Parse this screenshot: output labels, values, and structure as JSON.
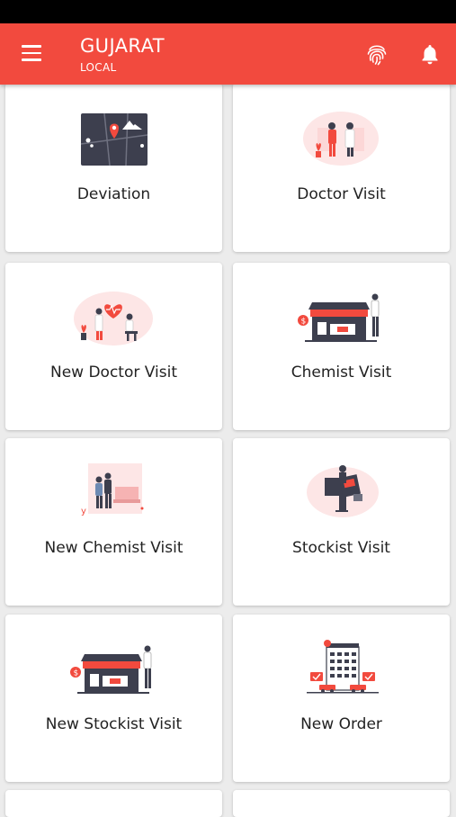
{
  "header": {
    "title": "GUJARAT",
    "subtitle": "LOCAL"
  },
  "cards": [
    {
      "label": "Deviation",
      "icon": "map-location-illustration"
    },
    {
      "label": "Doctor Visit",
      "icon": "doctor-visit-illustration"
    },
    {
      "label": "New Doctor Visit",
      "icon": "new-doctor-visit-illustration"
    },
    {
      "label": "Chemist Visit",
      "icon": "chemist-shop-illustration"
    },
    {
      "label": "New Chemist Visit",
      "icon": "new-chemist-visit-illustration"
    },
    {
      "label": "Stockist Visit",
      "icon": "stockist-visit-illustration"
    },
    {
      "label": "New Stockist Visit",
      "icon": "new-stockist-shop-illustration"
    },
    {
      "label": "New Order",
      "icon": "new-order-building-illustration"
    }
  ],
  "colors": {
    "accent": "#f24a3e",
    "background": "#ececec",
    "card": "#ffffff"
  }
}
